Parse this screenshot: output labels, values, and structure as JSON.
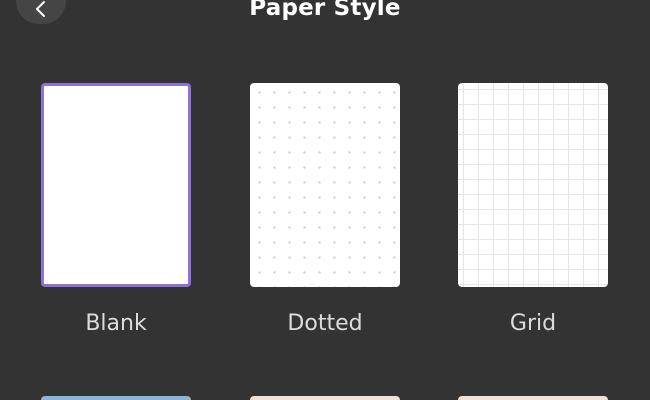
{
  "header": {
    "title": "Paper Style",
    "back_icon": "chevron-left-icon"
  },
  "paper_styles": [
    {
      "label": "Blank",
      "pattern": "blank",
      "selected": true
    },
    {
      "label": "Dotted",
      "pattern": "dotted",
      "selected": false
    },
    {
      "label": "Grid",
      "pattern": "grid",
      "selected": false
    }
  ],
  "colors": {
    "background": "#333333",
    "accent": "#8d72d6",
    "label_text": "#dcdcdc",
    "title_text": "#ffffff",
    "peek_row": [
      "#8fb6d8",
      "#efe1d6",
      "#efe1d6"
    ]
  }
}
